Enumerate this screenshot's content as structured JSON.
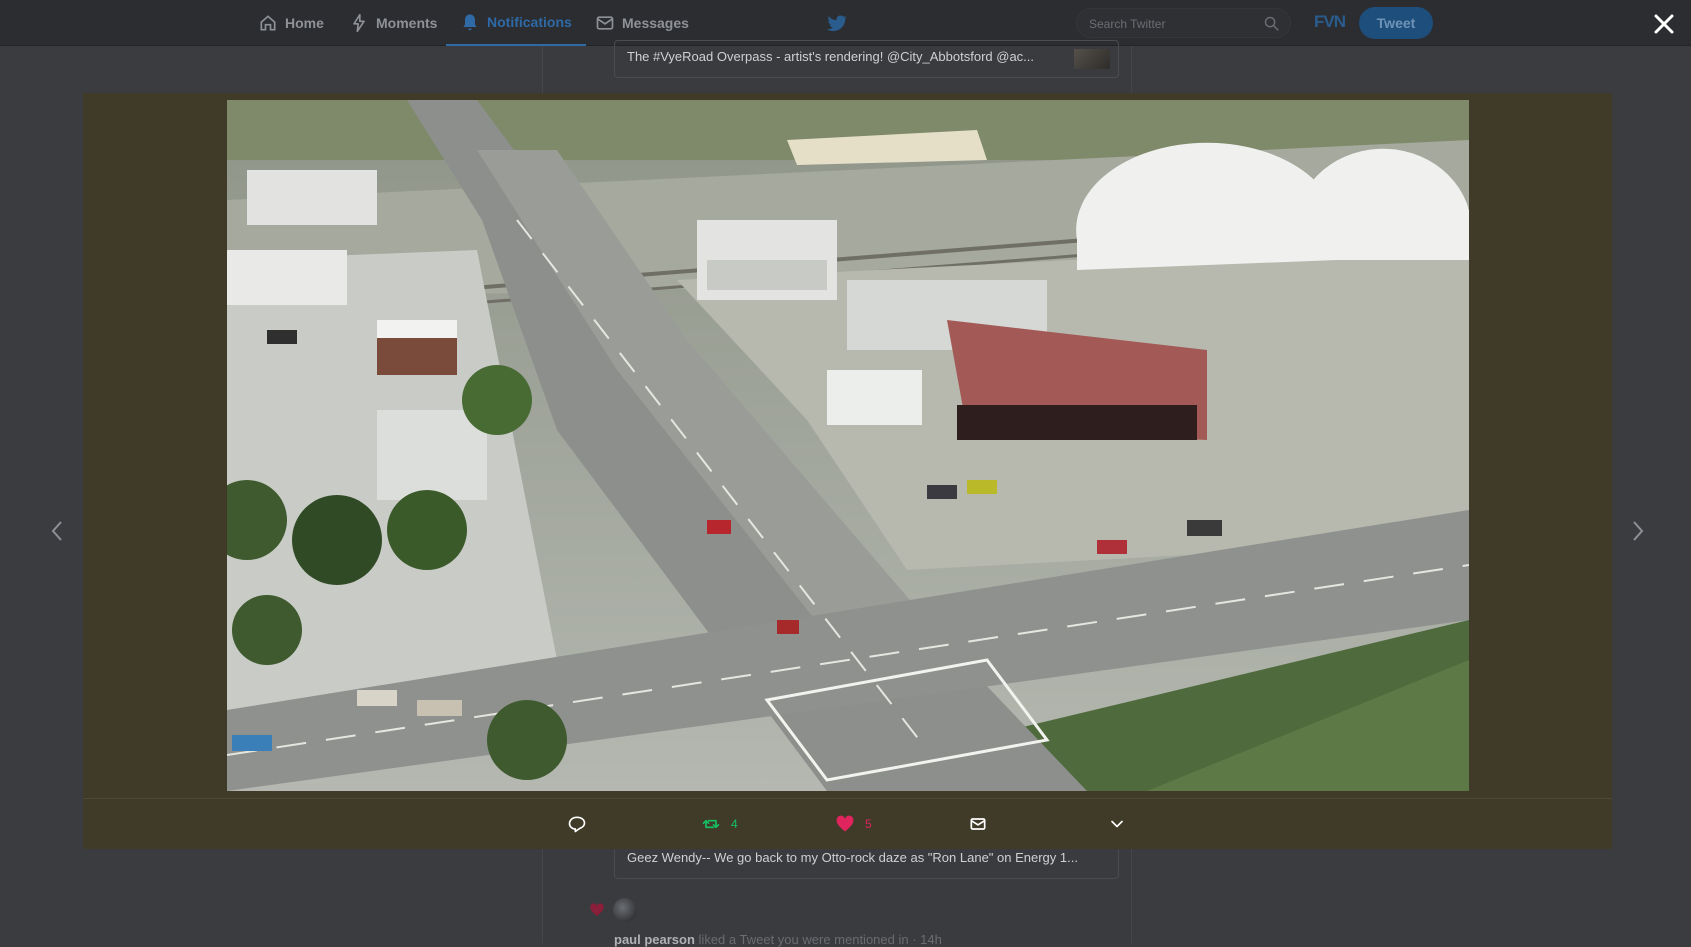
{
  "nav": {
    "home": "Home",
    "moments": "Moments",
    "notifications": "Notifications",
    "messages": "Messages",
    "search_placeholder": "Search Twitter",
    "brand": "FVN",
    "tweet_button": "Tweet"
  },
  "timeline": {
    "quoted_top": "The #VyeRoad Overpass - artist's rendering! @City_Abbotsford @ac...",
    "quoted_bottom": "Geez Wendy-- We go back to my Otto-rock daze as \"Ron Lane\" on Energy 1...",
    "liked_user": "paul pearson",
    "liked_action": "liked a Tweet you were mentioned in",
    "liked_time": "14h"
  },
  "modal": {
    "retweet_count": "4",
    "like_count": "5",
    "media_subject": "aerial rendering of road overpass and intersection"
  },
  "colors": {
    "accent": "#1da1f2",
    "retweet": "#17bf63",
    "like": "#e0245e",
    "modal_bg": "#3f3b28"
  }
}
